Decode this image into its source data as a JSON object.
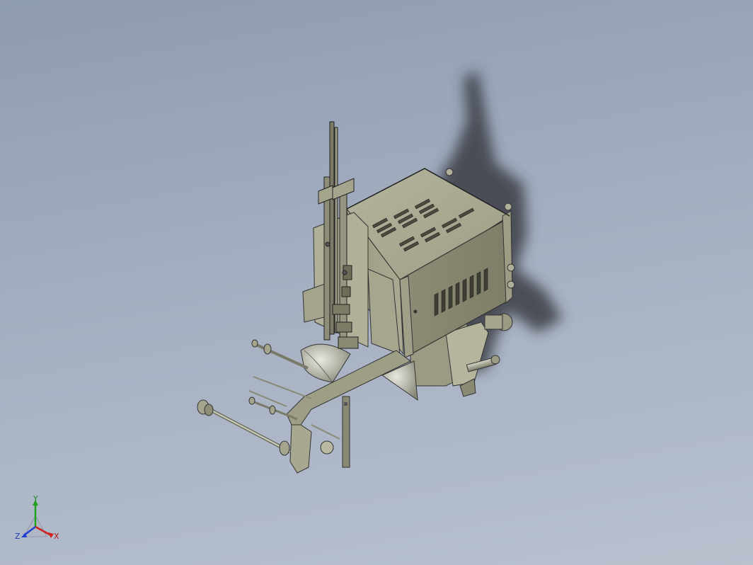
{
  "viewport": {
    "background_top": "#8e9bb0",
    "background_bottom": "#b9c1cf",
    "part_color": "#a8a88f",
    "part_shade": "#8c8c74",
    "part_dark": "#5c5c4c",
    "shadow_color": "#3a3e44"
  },
  "triad": {
    "y_label": "Y",
    "z_label": "Z",
    "x_label": "X",
    "y_color": "#1fa01f",
    "x_color": "#d02020",
    "z_color": "#2040d0"
  }
}
